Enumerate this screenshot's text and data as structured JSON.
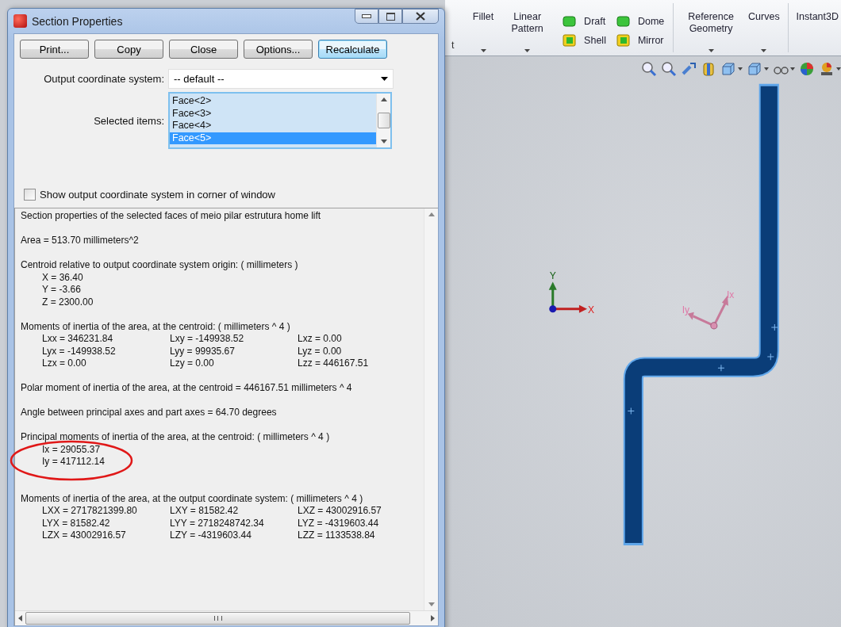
{
  "window": {
    "title": "Section Properties"
  },
  "buttons": [
    {
      "label": "Print...",
      "default": false
    },
    {
      "label": "Copy",
      "default": false
    },
    {
      "label": "Close",
      "default": false
    },
    {
      "label": "Options...",
      "default": false
    },
    {
      "label": "Recalculate",
      "default": true
    }
  ],
  "output_coordinate_system": {
    "label": "Output coordinate system:",
    "value": "-- default --"
  },
  "selected_items": {
    "label": "Selected items:",
    "items": [
      {
        "label": "Face<2>",
        "selected": false
      },
      {
        "label": "Face<3>",
        "selected": false
      },
      {
        "label": "Face<4>",
        "selected": false
      },
      {
        "label": "Face<5>",
        "selected": true
      }
    ]
  },
  "show_coordinate_system": {
    "label": "Show output coordinate system in corner of window",
    "checked": false
  },
  "results": [
    {
      "kind": "text",
      "text": "Section properties of the selected faces of meio pilar estrutura home lift"
    },
    {
      "kind": "text",
      "text": "Area = 513.70 millimeters^2"
    },
    {
      "kind": "list",
      "heading": "Centroid relative to output coordinate system origin: ( millimeters )",
      "lines": [
        "X = 36.40",
        "Y = -3.66",
        "Z = 2300.00"
      ]
    },
    {
      "kind": "grid",
      "heading": "Moments of inertia of the area, at the centroid: ( millimeters ^ 4 )",
      "rows": [
        [
          "Lxx = 346231.84",
          "Lxy = -149938.52",
          "Lxz = 0.00"
        ],
        [
          "Lyx = -149938.52",
          "Lyy = 99935.67",
          "Lyz = 0.00"
        ],
        [
          "Lzx = 0.00",
          "Lzy = 0.00",
          "Lzz = 446167.51"
        ]
      ]
    },
    {
      "kind": "text",
      "text": "Polar moment of inertia of the area, at the centroid = 446167.51 millimeters ^ 4"
    },
    {
      "kind": "text",
      "text": "Angle between principal axes and part axes = 64.70 degrees"
    },
    {
      "kind": "list",
      "heading": "Principal moments of inertia of the area, at the centroid: ( millimeters ^ 4 )",
      "lines": [
        "Ix = 29055.37",
        "Iy = 417112.14"
      ],
      "circled": true
    },
    {
      "kind": "grid",
      "heading": "Moments of inertia of the area, at the output coordinate system: ( millimeters ^ 4 )",
      "rows": [
        [
          "LXX = 2717821399.80",
          "LXY = 81582.42",
          "LXZ = 43002916.57"
        ],
        [
          "LYX = 81582.42",
          "LYY = 2718248742.34",
          "LYZ = -4319603.44"
        ],
        [
          "LZX = 43002916.57",
          "LZY = -4319603.44",
          "LZZ = 1133538.84"
        ]
      ]
    }
  ],
  "ribbon": {
    "cut_label": "t",
    "columns": [
      {
        "kind": "large",
        "label": "Fillet",
        "dropdown": true
      },
      {
        "kind": "large",
        "label": "Linear Pattern",
        "dropdown": true
      },
      {
        "kind": "stack",
        "items": [
          "Draft",
          "Shell"
        ]
      },
      {
        "kind": "stack",
        "items": [
          "Dome",
          "Mirror"
        ]
      },
      {
        "kind": "separator"
      },
      {
        "kind": "large",
        "label": "Reference Geometry",
        "dropdown": true
      },
      {
        "kind": "large",
        "label": "Curves",
        "dropdown": true
      },
      {
        "kind": "separator"
      },
      {
        "kind": "large",
        "label": "Instant3D",
        "dropdown": false
      }
    ]
  },
  "viewport": {
    "triad_labels": [
      "X",
      "Y"
    ],
    "principal_axis_labels": [
      "Ix",
      "Iy"
    ]
  }
}
